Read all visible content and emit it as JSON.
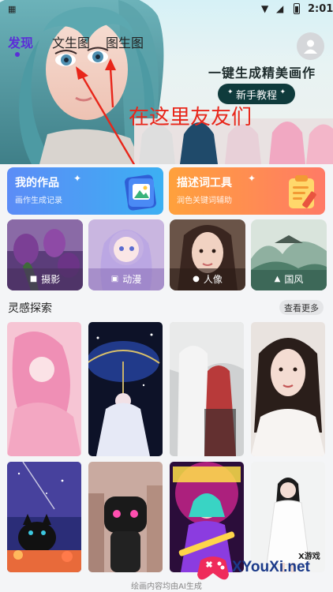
{
  "status_bar": {
    "time": "2:01"
  },
  "tabs": [
    {
      "label": "发现",
      "active": true
    },
    {
      "label": "文生图",
      "active": false
    },
    {
      "label": "图生图",
      "active": false
    }
  ],
  "hero": {
    "slogan": "一键生成精美画作",
    "tutorial_button": "新手教程",
    "annotation": "在这里友友们"
  },
  "cards": [
    {
      "title": "我的作品",
      "subtitle": "画作生成记录",
      "icon": "image-icon"
    },
    {
      "title": "描述词工具",
      "subtitle": "润色关键词辅助",
      "icon": "notepad-pencil-icon"
    }
  ],
  "styles": [
    {
      "label": "摄影",
      "icon": "video-camera-icon"
    },
    {
      "label": "动漫",
      "icon": "picture-icon"
    },
    {
      "label": "人像",
      "icon": "portrait-icon"
    },
    {
      "label": "国风",
      "icon": "pavilion-icon"
    }
  ],
  "inspiration": {
    "title": "灵感探索",
    "more": "查看更多"
  },
  "footer": {
    "notice": "绘画内容均由AI生成"
  },
  "watermark": {
    "small": "X游戏",
    "big": "XYouXi.net"
  },
  "colors": {
    "accent": "#5b2ed8",
    "annotation": "#e8261a",
    "tutorial_bg": "#0f3b3c"
  }
}
